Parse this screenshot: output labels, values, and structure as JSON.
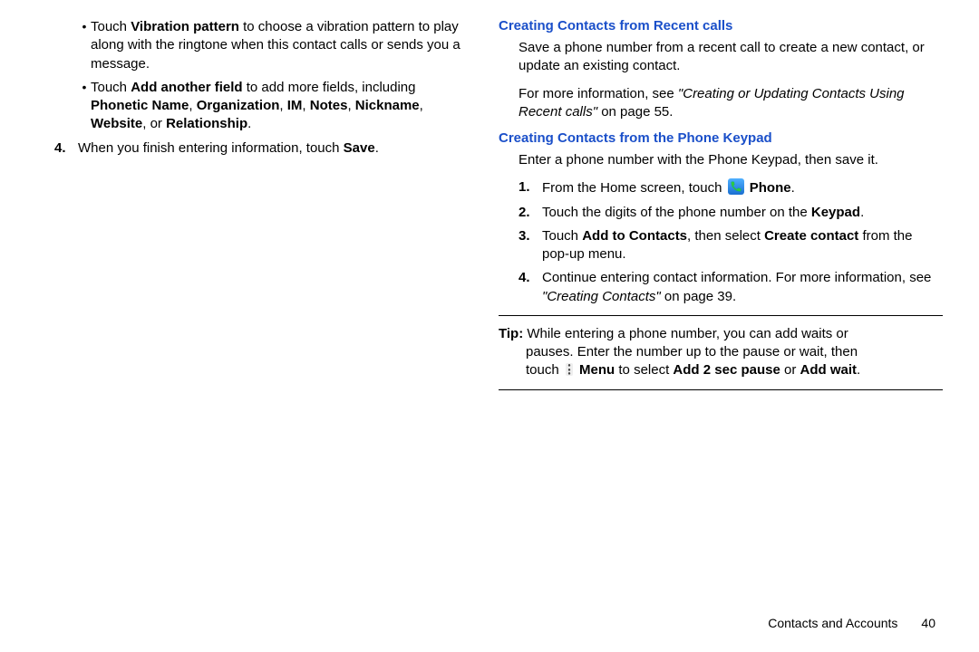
{
  "left": {
    "bullets": {
      "b1": {
        "pre": "Touch ",
        "bold": "Vibration pattern",
        "post": " to choose a vibration pattern to play along with the ringtone when this contact calls or sends you a message."
      },
      "b2": {
        "pre": "Touch ",
        "bold": "Add another field",
        "post": " to add more fields, including ",
        "bold2": "Phonetic Name",
        "c1": ", ",
        "bold3": "Organization",
        "c2": ", ",
        "bold4": "IM",
        "c3": ", ",
        "bold5": "Notes",
        "c4": ", ",
        "bold6": "Nickname",
        "c5": ", ",
        "bold7": "Website",
        "c6": ", or ",
        "bold8": "Relationship",
        "c7": "."
      }
    },
    "step4": {
      "num": "4.",
      "pre": "When you finish entering information, touch ",
      "bold": "Save",
      "post": "."
    }
  },
  "right": {
    "h1": "Creating Contacts from Recent calls",
    "p1": "Save a phone number from a recent call to create a new contact, or update an existing contact.",
    "p2a": "For more information, see ",
    "p2i": "\"Creating or Updating Contacts Using Recent calls\"",
    "p2b": " on page 55.",
    "h2": "Creating Contacts from the Phone Keypad",
    "p3": "Enter a phone number with the Phone Keypad, then save it.",
    "s1": {
      "num": "1.",
      "pre": "From the Home screen, touch ",
      "bold": "Phone",
      "post": "."
    },
    "s2": {
      "num": "2.",
      "pre": "Touch the digits of the phone number on the ",
      "bold": "Keypad",
      "post": "."
    },
    "s3": {
      "num": "3.",
      "pre": "Touch ",
      "bold1": "Add to Contacts",
      "mid": ", then select ",
      "bold2": "Create contact",
      "post": " from the pop-up menu."
    },
    "s4": {
      "num": "4.",
      "pre": "Continue entering contact information. For more information, see ",
      "i": "\"Creating Contacts\"",
      "post": " on page 39."
    },
    "tip": {
      "label": "Tip:",
      "line1": " While entering a phone number, you can add waits or",
      "line2": "pauses. Enter the number up to the pause or wait, then",
      "line3a": "touch ",
      "bold1": "Menu",
      "line3b": " to select ",
      "bold2": "Add 2 sec pause",
      "line3c": " or ",
      "bold3": "Add wait",
      "line3d": "."
    }
  },
  "footer": {
    "section": "Contacts and Accounts",
    "page": "40"
  }
}
